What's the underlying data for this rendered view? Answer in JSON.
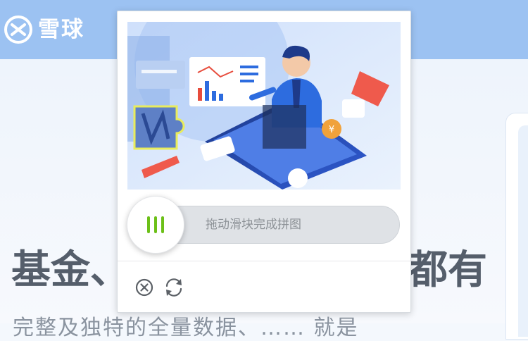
{
  "header": {
    "logo_text": "雪球",
    "brand_color": "#9cc2f2"
  },
  "hero": {
    "headline_left": "基金、",
    "headline_right": "都有",
    "subline": "完整及独特的全量数据、…… 就是"
  },
  "captcha": {
    "slider_hint": "拖动滑块完成拼图",
    "knob_accent_color": "#6cc018",
    "close_icon": "close-circle-icon",
    "refresh_icon": "refresh-icon"
  }
}
